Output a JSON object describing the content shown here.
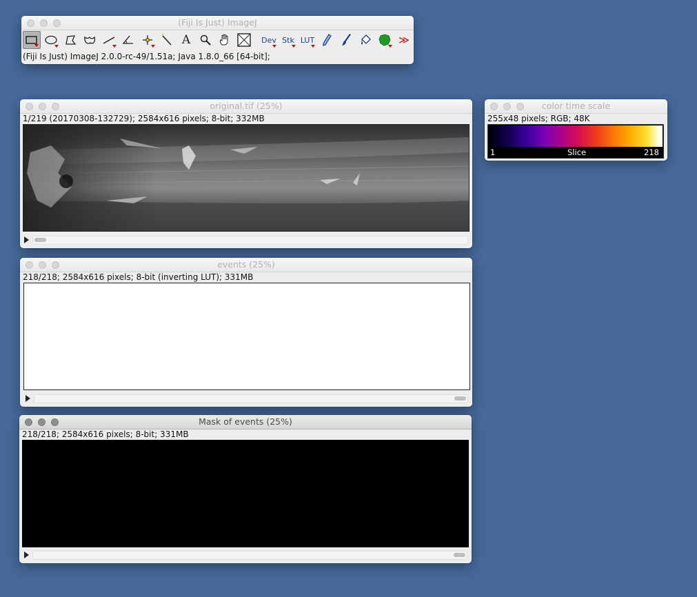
{
  "main_window": {
    "title": "(Fiji Is Just) ImageJ",
    "status": "(Fiji Is Just) ImageJ 2.0.0-rc-49/1.51a; Java 1.8.0_66 [64-bit];",
    "tools": {
      "dev": "Dev",
      "stk": "Stk",
      "lut": "LUT",
      "text": "A",
      "more": "≫"
    }
  },
  "original_window": {
    "title": "original.tif (25%)",
    "info": "1/219 (20170308-132729); 2584x616 pixels; 8-bit; 332MB"
  },
  "events_window": {
    "title": "events (25%)",
    "info": "218/218; 2584x616 pixels; 8-bit (inverting LUT); 331MB"
  },
  "mask_window": {
    "title": "Mask of events (25%)",
    "info": "218/218; 2584x616 pixels; 8-bit; 331MB"
  },
  "color_scale_window": {
    "title": "color time scale",
    "info": "255x48 pixels; RGB; 48K",
    "label_min": "1",
    "label_mid": "Slice",
    "label_max": "218"
  },
  "colors": {
    "desktop": "#46699a"
  }
}
